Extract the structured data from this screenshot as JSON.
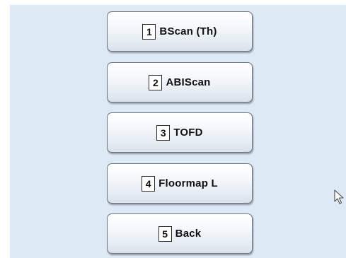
{
  "menu": {
    "buttons": [
      {
        "key": "1",
        "label": "BScan (Th)"
      },
      {
        "key": "2",
        "label": "ABIScan"
      },
      {
        "key": "3",
        "label": "TOFD"
      },
      {
        "key": "4",
        "label": "Floormap L"
      },
      {
        "key": "5",
        "label": "Back"
      }
    ]
  },
  "cursor": {
    "icon": "arrow-pointer-icon"
  }
}
